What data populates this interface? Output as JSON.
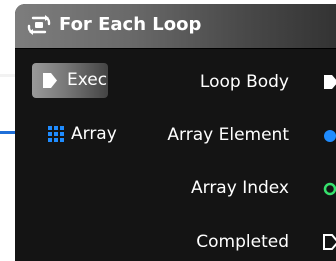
{
  "node": {
    "title": "For Each Loop",
    "icon": "loop-icon"
  },
  "inputs": [
    {
      "label": "Exec",
      "icon": "exec-input-icon",
      "color": "#f2f2f2"
    },
    {
      "label": "Array",
      "icon": "array-grid-icon",
      "color": "#1f8cff"
    }
  ],
  "outputs": [
    {
      "label": "Loop Body",
      "icon": "exec-output-icon",
      "color": "#ffffff"
    },
    {
      "label": "Array Element",
      "icon": "filled-blue-pin-icon",
      "color": "#1f8cff"
    },
    {
      "label": "Array Index",
      "icon": "hollow-green-pin-icon",
      "color": "#36e06c"
    },
    {
      "label": "Completed",
      "icon": "hollow-exec-output-icon",
      "color": "#ffffff"
    }
  ]
}
